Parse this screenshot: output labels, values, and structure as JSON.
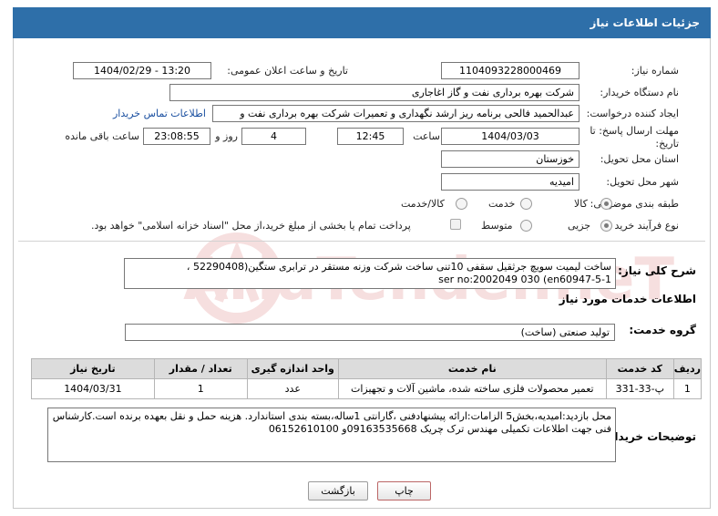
{
  "header": {
    "title": "جزئیات اطلاعات نیاز"
  },
  "form": {
    "need_number_label": "شماره نیاز:",
    "need_number": "1104093228000469",
    "announce_label": "تاریخ و ساعت اعلان عمومی:",
    "announce_value": "1404/02/29 - 13:20",
    "buyer_org_label": "نام دستگاه خریدار:",
    "buyer_org": "شرکت بهره برداری نفت و گاز اغاجاری",
    "requester_label": "ایجاد کننده درخواست:",
    "requester": "عبدالحمید فالحی برنامه ریز ارشد نگهداری و تعمیرات شرکت بهره برداری نفت و",
    "contact_link": "اطلاعات تماس خریدار",
    "deadline_label": "مهلت ارسال پاسخ: تا تاریخ:",
    "deadline_date": "1404/03/03",
    "time_label": "ساعت",
    "deadline_time": "12:45",
    "days_value": "4",
    "days_label": "روز و",
    "remaining_time": "23:08:55",
    "remaining_label": "ساعت باقی مانده",
    "province_label": "استان محل تحویل:",
    "province": "خوزستان",
    "city_label": "شهر محل تحویل:",
    "city": "امیدیه",
    "category_label": "طبقه بندی موضوعی:",
    "category_options": [
      "کالا",
      "خدمت",
      "کالا/خدمت"
    ],
    "process_label": "نوع فرآیند خرید :",
    "process_options": [
      "جزیی",
      "متوسط"
    ],
    "payment_note": "پرداخت تمام یا بخشی از مبلغ خرید،از محل \"اسناد خزانه اسلامی\" خواهد بود."
  },
  "summary": {
    "label": "شرح کلی نیاز:",
    "line1": "ساخت لیمیت سویچ جرثقیل سقفی 10تنی ساخت شرکت وزنه مستقر در ترابری ستگین(52290408 ،",
    "line2": "ser no:2002049 030         (en60947-5-1"
  },
  "services": {
    "title": "اطلاعات خدمات مورد نیاز",
    "group_label": "گروه خدمت:",
    "group_value": "تولید صنعتی (ساخت)",
    "columns": [
      "ردیف",
      "کد خدمت",
      "نام خدمت",
      "واحد اندازه گیری",
      "تعداد / مقدار",
      "تاریخ نیاز"
    ],
    "rows": [
      [
        "1",
        "پ-33-331",
        "تعمیر محصولات فلزی ساخته شده، ماشین آلات و تجهیزات",
        "عدد",
        "1",
        "1404/03/31"
      ]
    ]
  },
  "buyer_notes": {
    "label": "توضیحات خریدار:",
    "text": "محل بازدید:امیدیه،بخش5 الزامات:ارائه پیشنهادفنی ،گارانتی 1ساله،بسته بندی استاندارد. هزینه حمل و نقل بعهده برنده است.کارشناس فنی جهت اطلاعات تکمیلی مهندس ترک چریک 09163535668و 06152610100"
  },
  "buttons": {
    "print": "چاپ",
    "back": "بازگشت"
  },
  "watermark": {
    "text": "AriaTender.neT"
  },
  "colors": {
    "header_bg": "#2e6fa9",
    "link": "#1a4fa0",
    "watermark": "#c62828"
  }
}
